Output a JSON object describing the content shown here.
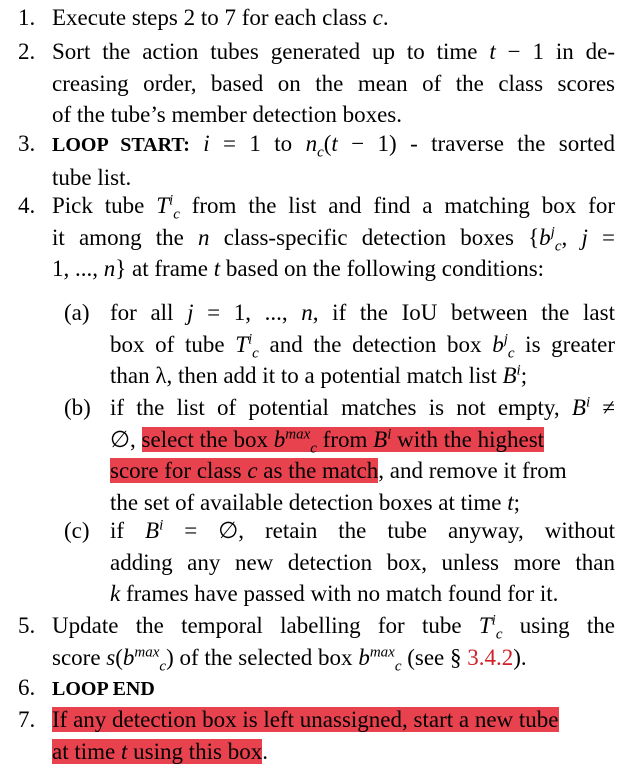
{
  "highlight_color": "#e8424f",
  "steps": {
    "s1": {
      "num": "1.",
      "pre": "Execute steps 2 to 7 for each class ",
      "var": "c",
      "post": "."
    },
    "s2": {
      "num": "2.",
      "l1a": "Sort the action tubes generated up to time ",
      "l1t": "t",
      "l1b": " − 1 in de-",
      "l2": "creasing order, based on the mean of the class scores",
      "l3": "of the tube’s member detection boxes."
    },
    "s3": {
      "num": "3.",
      "bold": "LOOP START:",
      "l1a": " i",
      "l1b": " = 1 to ",
      "l1c": "n",
      "l1d": "(",
      "l1e": "t",
      "l1f": " − 1) - traverse the sorted",
      "l2": "tube list."
    },
    "s4": {
      "num": "4.",
      "l1a": "Pick tube ",
      "T": "T",
      "l1b": " from the list and find a matching box for",
      "l2a": "it among the ",
      "n": "n",
      "l2b": " class-specific detection boxes {",
      "b": "b",
      "l2c": ", ",
      "j": "j",
      "l2d": " =",
      "l3a": "1, ..., ",
      "l3b": "n",
      "l3c": "} at frame ",
      "l3d": "t",
      "l3e": " based on the following conditions:"
    },
    "s4a": {
      "lab": "(a)",
      "l1a": "for all ",
      "l1b": "j",
      "l1c": " = 1, ..., ",
      "l1d": "n",
      "l1e": ", if the IoU between the last",
      "l2a": "box of tube ",
      "l2b": "T",
      "l2c": " and the detection box ",
      "l2d": "b",
      "l2e": " is greater",
      "l3a": "than λ, then add it to a potential match list ",
      "l3b": "B",
      "l3c": ";"
    },
    "s4b": {
      "lab": "(b)",
      "l1a": "if the list of potential matches is not empty, ",
      "l1b": "B",
      "l1c": " ≠",
      "l2a": "∅, ",
      "l2hl1": "select the box ",
      "l2hlb": "b",
      "l2hl2": " from ",
      "l2hlB": "B",
      "l2hl3": " with the highest",
      "l3hl1": "score for class ",
      "l3hlc": "c",
      "l3hl2": " as the match",
      "l3b": ", and remove it from",
      "l4a": "the set of available detection boxes at time ",
      "l4b": "t",
      "l4c": ";"
    },
    "s4c": {
      "lab": "(c)",
      "l1a": "if ",
      "l1b": "B",
      "l1c": " = ∅, retain the tube anyway, without",
      "l2": "adding any new detection box, unless more than",
      "l3a": "k",
      "l3b": " frames have passed with no match found for it."
    },
    "s5": {
      "num": "5.",
      "l1a": "Update the temporal labelling for tube ",
      "l1b": "T",
      "l1c": " using the",
      "l2a": "score ",
      "l2b": "s",
      "l2c": "(",
      "l2d": "b",
      "l2e": ") of the selected box ",
      "l2f": "b",
      "l2g": " (see § ",
      "ref": "3.4.2",
      "l2h": ")."
    },
    "s6": {
      "num": "6.",
      "bold": "LOOP END"
    },
    "s7": {
      "num": "7.",
      "l1": "If any detection box is left unassigned, start a new tube",
      "l2a": "at time ",
      "l2b": "t",
      "l2c": " using this box",
      "l2d": "."
    }
  },
  "scripts": {
    "i": "i",
    "c": "c",
    "j": "j",
    "max": "max"
  }
}
